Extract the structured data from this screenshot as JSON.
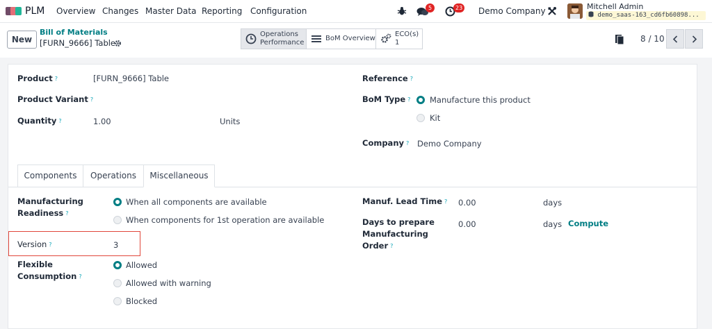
{
  "navbar": {
    "app_name": "PLM",
    "menu": [
      "Overview",
      "Changes",
      "Master Data",
      "Reporting",
      "Configuration"
    ],
    "messages_count": "5",
    "activities_count": "23",
    "company": "Demo Company",
    "user_name": "Mitchell Admin",
    "database": "demo_saas-163_cd6fb60898..."
  },
  "control": {
    "new_label": "New",
    "breadcrumb": "Bill of Materials",
    "record_name": "[FURN_9666] Table",
    "smart_buttons": {
      "operations_line1": "Operations",
      "operations_line2": "Performance",
      "bom_overview": "BoM Overview",
      "eco_label": "ECO(s)",
      "eco_count": "1"
    },
    "pager": "8 / 10"
  },
  "form": {
    "product_label": "Product",
    "product_value": "[FURN_9666] Table",
    "variant_label": "Product Variant",
    "quantity_label": "Quantity",
    "quantity_value": "1.00",
    "quantity_uom": "Units",
    "reference_label": "Reference",
    "bom_type_label": "BoM Type",
    "bom_type_options": [
      "Manufacture this product",
      "Kit"
    ],
    "bom_type_selected": "Manufacture this product",
    "company_label": "Company",
    "company_value": "Demo Company",
    "help_mark": "?"
  },
  "tabs": [
    "Components",
    "Operations",
    "Miscellaneous"
  ],
  "active_tab": "Miscellaneous",
  "misc": {
    "readiness_label_1": "Manufacturing",
    "readiness_label_2": "Readiness",
    "readiness_options": [
      "When all components are available",
      "When components for 1st operation are available"
    ],
    "readiness_selected": "When all components are available",
    "version_label": "Version",
    "version_value": "3",
    "flexible_label_1": "Flexible",
    "flexible_label_2": "Consumption",
    "flexible_options": [
      "Allowed",
      "Allowed with warning",
      "Blocked"
    ],
    "flexible_selected": "Allowed",
    "lead_time_label": "Manuf. Lead Time",
    "lead_time_value": "0.00",
    "lead_time_unit": "days",
    "days_prepare_label_1": "Days to prepare",
    "days_prepare_label_2": "Manufacturing",
    "days_prepare_label_3": "Order",
    "days_prepare_value": "0.00",
    "days_prepare_unit": "days",
    "compute_label": "Compute"
  },
  "colors": {
    "accent": "#017e84",
    "highlight_box": "#e0463a",
    "badge": "#e02424"
  }
}
